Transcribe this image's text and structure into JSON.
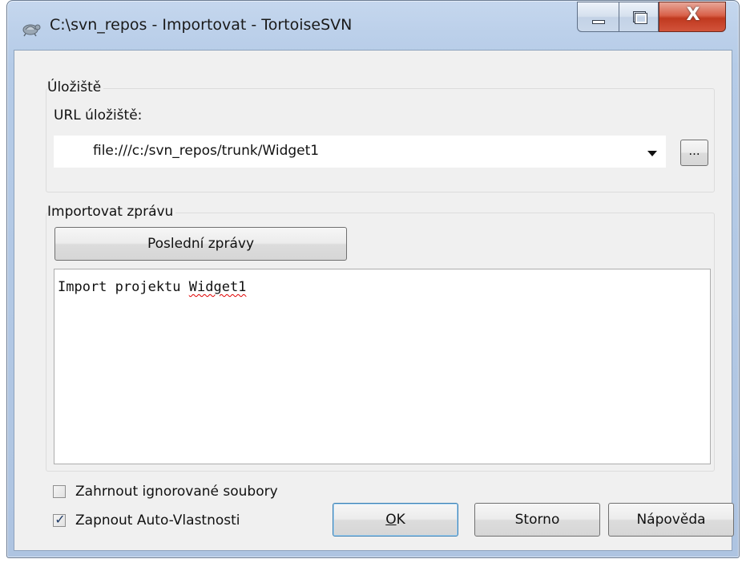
{
  "window": {
    "title": "C:\\svn_repos - Importovat - TortoiseSVN",
    "close_glyph": "X"
  },
  "repository": {
    "group_title": "Úložiště",
    "url_label": "URL úložiště:",
    "url_value": "file:///c:/svn_repos/trunk/Widget1",
    "browse_label": "..."
  },
  "message": {
    "group_title": "Importovat zprávu",
    "recent_button": "Poslední zprávy",
    "text_prefix": "Import projektu ",
    "text_misspelled": "Widget1"
  },
  "options": {
    "include_ignored_label": "Zahrnout ignorované soubory",
    "include_ignored_checked": false,
    "auto_props_label": "Zapnout Auto-Vlastnosti",
    "auto_props_checked": true,
    "check_glyph": "✓"
  },
  "buttons": {
    "ok_mnemonic": "O",
    "ok_rest": "K",
    "cancel": "Storno",
    "help": "Nápověda"
  }
}
